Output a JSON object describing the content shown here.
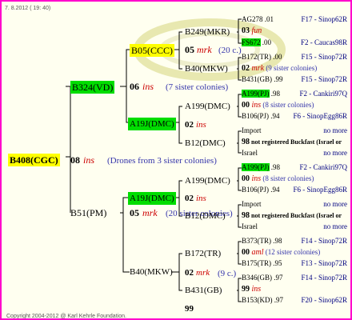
{
  "header": {
    "date": "7. 8.2012 ( 19: 40)"
  },
  "root": {
    "id": "B408(CGC)",
    "year": "08",
    "ins": "ins",
    "note": "(Drones from 3 sister colonies)"
  },
  "sire": {
    "id": "B324(VD)",
    "year": "06",
    "ins": "ins",
    "note": "(7 sister colonies)"
  },
  "ss": {
    "id": "B05(CCC)",
    "year": "05",
    "mark": "mrk",
    "note": "(20 c.)"
  },
  "sd": {
    "id": "A19J(DMC)"
  },
  "dam": {
    "id": "B51(PM)",
    "year": "05",
    "mark": "mrk",
    "note": "(20 sister colonies)"
  },
  "ds": {
    "id": "A19J(DMC)"
  },
  "nodes": {
    "b249": "B249(MKR)",
    "b40a": "B40(MKW)",
    "a199a": "A199(DMC)",
    "b12a": "B12(DMC)",
    "a199b": "A199(DMC)",
    "b12b": "B12(DMC)",
    "b40b": "B40(MKW)",
    "b172": "B172(TR)",
    "b431": "B431(GB)"
  },
  "years": {
    "a": "02",
    "ains": "ins",
    "b": "02",
    "bins": "ins",
    "c": "02",
    "cmrk": "mrk",
    "cnote": "(9 c.)",
    "d": "99"
  },
  "ancestors": [
    {
      "id": "AG278",
      "year": ".01",
      "origin": "F17 - Sinop62R",
      "style": "plain"
    },
    {
      "year": "03",
      "mark": "fun",
      "style": "mark"
    },
    {
      "id": "FS672",
      "year": ".00",
      "origin": "F2 - Caucas98R",
      "style": "green"
    },
    {
      "id": "B172(TR)",
      "year": ".00",
      "origin": "F15 - Sinop72R",
      "style": "plain"
    },
    {
      "year": "02",
      "mark": "mrk",
      "note": "(9 sister colonies)",
      "style": "mark"
    },
    {
      "id": "B431(GB)",
      "year": ".99",
      "origin": "F15 - Sinop72R",
      "style": "plain"
    },
    {
      "id": "A199(PJ)",
      "year": ".98",
      "origin": "F2 - Cankiri97Q",
      "style": "green"
    },
    {
      "year": "00",
      "mark": "ins",
      "note": "(8 sister colonies)",
      "style": "mark"
    },
    {
      "id": "B106(PJ)",
      "year": ".94",
      "origin": "F6 - SinopEgg86R",
      "style": "plain"
    },
    {
      "id": "Import",
      "origin": "no more",
      "style": "plain"
    },
    {
      "year": "98",
      "note": "not registered Buckfast (Israel or",
      "style": "bold"
    },
    {
      "id": "Israel",
      "origin": "no more",
      "style": "plain"
    },
    {
      "id": "A199(PJ)",
      "year": ".98",
      "origin": "F2 - Cankiri97Q",
      "style": "green"
    },
    {
      "year": "00",
      "mark": "ins",
      "note": "(8 sister colonies)",
      "style": "mark"
    },
    {
      "id": "B106(PJ)",
      "year": ".94",
      "origin": "F6 - SinopEgg86R",
      "style": "plain"
    },
    {
      "id": "Import",
      "origin": "no more",
      "style": "plain"
    },
    {
      "year": "98",
      "note": "not registered Buckfast (Israel or",
      "style": "bold"
    },
    {
      "id": "Israel",
      "origin": "no more",
      "style": "plain"
    },
    {
      "id": "B373(TR)",
      "year": ".98",
      "origin": "F14 - Sinop72R",
      "style": "plain"
    },
    {
      "year": "00",
      "mark": "aml",
      "note": "(12 sister colonies)",
      "style": "mark"
    },
    {
      "id": "B175(TR)",
      "year": ".95",
      "origin": "F13 - Sinop72R",
      "style": "plain"
    },
    {
      "id": "B346(GB)",
      "year": ".97",
      "origin": "F14 - Sinop72R",
      "style": "plain"
    },
    {
      "year": "99",
      "mark": "ins",
      "style": "mark"
    },
    {
      "id": "B153(KD)",
      "year": ".97",
      "origin": "F20 - Sinop62R",
      "style": "plain"
    }
  ],
  "footer": {
    "copyright": "Copyright 2004-2012 @ Karl Kehrle Foundation."
  }
}
